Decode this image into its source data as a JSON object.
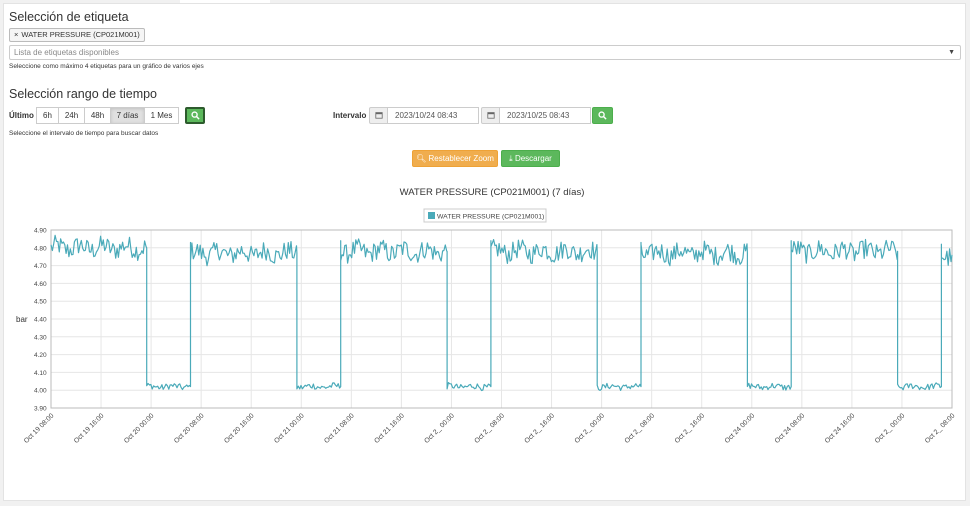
{
  "tag_section": {
    "title": "Selección de etiqueta",
    "selected_tag": "WATER PRESSURE (CP021M001)",
    "remove_symbol": "×",
    "select_placeholder": "Lista de etiquetas disponibles",
    "help": "Seleccione como máximo 4 etiquetas para un gráfico de varios ejes"
  },
  "time_section": {
    "title": "Selección rango de tiempo",
    "last_label": "Último",
    "ranges": [
      "6h",
      "24h",
      "48h",
      "7 días",
      "1 Mes"
    ],
    "active_range": "7 días",
    "interval_label": "Intervalo",
    "start": "2023/10/24 08:43",
    "end": "2023/10/25 08:43",
    "help": "Seleccione el intervalo de tiempo para buscar datos"
  },
  "actions": {
    "reset_zoom": "Restablecer Zoom",
    "download": "Descargar"
  },
  "colors": {
    "series": "#4aaab9",
    "green": "#5cb85c",
    "orange": "#f0ad4e"
  },
  "chart_data": {
    "type": "line",
    "title": "WATER PRESSURE (CP021M001) (7 días)",
    "legend": "WATER PRESSURE (CP021M001)",
    "legend_position": "top-center",
    "ylabel": "bar",
    "grid": true,
    "y_tick_labels": [
      "4.90",
      "4.80",
      "4.70",
      "4.60",
      "4.50",
      "4.40",
      "4.30",
      "4.20",
      "4.10",
      "4.00",
      "3.90"
    ],
    "x_tick_labels": [
      "Oct 19 08:00",
      "Oct 19 16:00",
      "Oct 20 00:00",
      "Oct 20 08:00",
      "Oct 20 16:00",
      "Oct 21 00:00",
      "Oct 21 08:00",
      "Oct 21 16:00",
      "Oct 2_ 00:00",
      "Oct 2_ 08:00",
      "Oct 2_ 16:00",
      "Oct 2_ 00:00",
      "Oct 2_ 08:00",
      "Oct 2_ 16:00",
      "Oct 24 00:00",
      "Oct 24 08:00",
      "Oct 24 16:00",
      "Oct 2_ 00:00",
      "Oct 2_ 08:00"
    ],
    "y_range": [
      3.9,
      4.9
    ],
    "x_range_hours": [
      0,
      144
    ],
    "x_unit": "hours since Oct 19 08:00",
    "series": [
      {
        "name": "WATER PRESSURE (CP021M001)",
        "segments": [
          {
            "from": 0,
            "to": 15.3,
            "level": 4.8
          },
          {
            "from": 15.3,
            "to": 22.3,
            "level": 4.02
          },
          {
            "from": 22.3,
            "to": 39.3,
            "level": 4.77
          },
          {
            "from": 39.3,
            "to": 46.3,
            "level": 4.02
          },
          {
            "from": 46.3,
            "to": 63.3,
            "level": 4.78
          },
          {
            "from": 63.3,
            "to": 70.3,
            "level": 4.02
          },
          {
            "from": 70.3,
            "to": 87.3,
            "level": 4.78
          },
          {
            "from": 87.3,
            "to": 94.3,
            "level": 4.02
          },
          {
            "from": 94.3,
            "to": 111.3,
            "level": 4.77
          },
          {
            "from": 111.3,
            "to": 118.3,
            "level": 4.02
          },
          {
            "from": 118.3,
            "to": 135.3,
            "level": 4.78
          },
          {
            "from": 135.3,
            "to": 142.3,
            "level": 4.02
          },
          {
            "from": 142.3,
            "to": 144,
            "level": 4.76
          }
        ]
      }
    ]
  }
}
